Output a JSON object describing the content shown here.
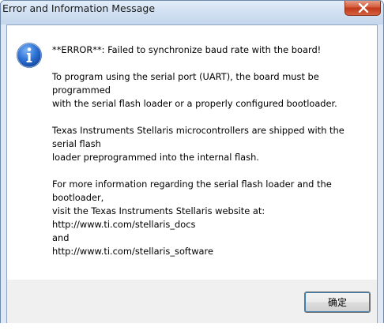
{
  "window": {
    "title": "Error and Information Message"
  },
  "message": {
    "error_line": "**ERROR**: Failed to synchronize baud rate with the board!",
    "paragraph2": [
      "To program using the serial port (UART), the board must be",
      "programmed",
      "with the serial flash loader or a properly configured bootloader."
    ],
    "paragraph3": [
      "Texas Instruments Stellaris microcontrollers are shipped with the",
      "serial flash",
      "loader preprogrammed into the internal flash."
    ],
    "paragraph4": [
      "For more information regarding the serial flash loader and the",
      "bootloader,",
      "visit the Texas Instruments Stellaris website at:",
      "http://www.ti.com/stellaris_docs",
      "and",
      "http://www.ti.com/stellaris_software"
    ]
  },
  "buttons": {
    "ok_label": "确定"
  },
  "icons": {
    "message_icon": "info-icon",
    "close": "close-icon"
  },
  "colors": {
    "close_button": "#c0391a",
    "info_icon": "#1f5fbf"
  }
}
